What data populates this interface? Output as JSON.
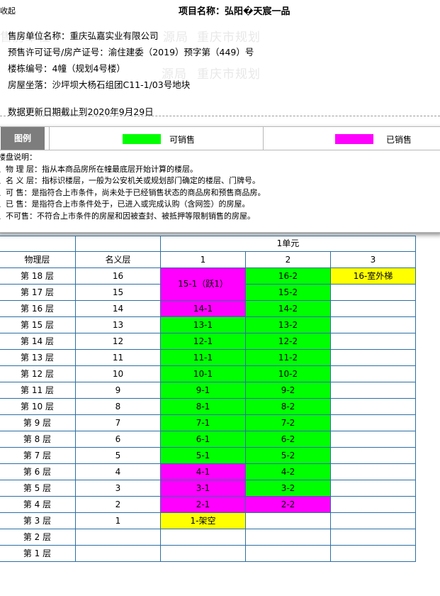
{
  "header": {
    "collapse_label": "收起",
    "project_title": "项目名称：弘阳�天宸一品"
  },
  "info": {
    "developer": "售房单位名称：重庆弘嘉实业有限公司",
    "permit": "预售许可证号/房产证号：渝住建委（2019）预字第（449）号",
    "building": "楼栋编号：4幢（规划4号楼）",
    "location": "房屋坐落：沙坪坝大杨石组团C11-1/03号地块",
    "update": "数据更新日期截止到2020年9月29日"
  },
  "watermarks": [
    "售房单位",
    "源局",
    "重庆市规划",
    "源局",
    "重庆市规划"
  ],
  "legend": {
    "tag": "图例",
    "available_label": "可销售",
    "sold_label": "已销售",
    "available_color": "#00ff00",
    "sold_color": "#ff00ff"
  },
  "notes": [
    "楼盘说明：",
    "、物 理 层：指从本商品房所在幢最底层开始计算的楼层。",
    "、名 义 层：指标识楼层，一般为公安机关或规划部门确定的楼层、门牌号。",
    "、可 售：是指符合上市条件，尚未处于已经销售状态的商品房和预售商品房。",
    "、已 售：是指符合上市条件处于，已进入或完成认购（含网签）的房屋。",
    "、不可售：不符合上市条件的房屋和因被查封、被抵押等限制销售的房屋。"
  ],
  "table": {
    "col_physical": "物理层",
    "col_nominal": "名义层",
    "unit_header": "1单元",
    "unit_cols": [
      "1",
      "2",
      "3"
    ],
    "colors": {
      "green": "#00ff00",
      "magenta": "#ff00ff",
      "yellow": "#ffff00"
    },
    "rows": [
      {
        "physical": "第 18 层",
        "nominal": "16"
      },
      {
        "physical": "第 17 层",
        "nominal": "15"
      },
      {
        "physical": "第 16 层",
        "nominal": "14"
      },
      {
        "physical": "第 15 层",
        "nominal": "13"
      },
      {
        "physical": "第 14 层",
        "nominal": "12"
      },
      {
        "physical": "第 13 层",
        "nominal": "11"
      },
      {
        "physical": "第 12 层",
        "nominal": "10"
      },
      {
        "physical": "第 11 层",
        "nominal": "9"
      },
      {
        "physical": "第 10 层",
        "nominal": "8"
      },
      {
        "physical": "第 9 层",
        "nominal": "7"
      },
      {
        "physical": "第 8 层",
        "nominal": "6"
      },
      {
        "physical": "第 7 层",
        "nominal": "5"
      },
      {
        "physical": "第 6 层",
        "nominal": "4"
      },
      {
        "physical": "第 5 层",
        "nominal": "3"
      },
      {
        "physical": "第 4 层",
        "nominal": "2"
      },
      {
        "physical": "第 3 层",
        "nominal": "1"
      },
      {
        "physical": "第 2 层",
        "nominal": ""
      },
      {
        "physical": "第 1 层",
        "nominal": ""
      }
    ],
    "units": [
      {
        "label": "15-1（跃1）",
        "col": 0,
        "row": 0,
        "span": 2,
        "status": "magenta"
      },
      {
        "label": "16-2",
        "col": 1,
        "row": 0,
        "span": 1,
        "status": "green"
      },
      {
        "label": "16-室外梯",
        "col": 2,
        "row": 0,
        "span": 1,
        "status": "yellow"
      },
      {
        "label": "15-2",
        "col": 1,
        "row": 1,
        "span": 1,
        "status": "green"
      },
      {
        "label": "14-1",
        "col": 0,
        "row": 2,
        "span": 1,
        "status": "magenta"
      },
      {
        "label": "14-2",
        "col": 1,
        "row": 2,
        "span": 1,
        "status": "green"
      },
      {
        "label": "13-1",
        "col": 0,
        "row": 3,
        "span": 1,
        "status": "green"
      },
      {
        "label": "13-2",
        "col": 1,
        "row": 3,
        "span": 1,
        "status": "green"
      },
      {
        "label": "12-1",
        "col": 0,
        "row": 4,
        "span": 1,
        "status": "green"
      },
      {
        "label": "12-2",
        "col": 1,
        "row": 4,
        "span": 1,
        "status": "green"
      },
      {
        "label": "11-1",
        "col": 0,
        "row": 5,
        "span": 1,
        "status": "green"
      },
      {
        "label": "11-2",
        "col": 1,
        "row": 5,
        "span": 1,
        "status": "green"
      },
      {
        "label": "10-1",
        "col": 0,
        "row": 6,
        "span": 1,
        "status": "green"
      },
      {
        "label": "10-2",
        "col": 1,
        "row": 6,
        "span": 1,
        "status": "green"
      },
      {
        "label": "9-1",
        "col": 0,
        "row": 7,
        "span": 1,
        "status": "green"
      },
      {
        "label": "9-2",
        "col": 1,
        "row": 7,
        "span": 1,
        "status": "green"
      },
      {
        "label": "8-1",
        "col": 0,
        "row": 8,
        "span": 1,
        "status": "green"
      },
      {
        "label": "8-2",
        "col": 1,
        "row": 8,
        "span": 1,
        "status": "green"
      },
      {
        "label": "7-1",
        "col": 0,
        "row": 9,
        "span": 1,
        "status": "green"
      },
      {
        "label": "7-2",
        "col": 1,
        "row": 9,
        "span": 1,
        "status": "green"
      },
      {
        "label": "6-1",
        "col": 0,
        "row": 10,
        "span": 1,
        "status": "green"
      },
      {
        "label": "6-2",
        "col": 1,
        "row": 10,
        "span": 1,
        "status": "green"
      },
      {
        "label": "5-1",
        "col": 0,
        "row": 11,
        "span": 1,
        "status": "green"
      },
      {
        "label": "5-2",
        "col": 1,
        "row": 11,
        "span": 1,
        "status": "green"
      },
      {
        "label": "4-1",
        "col": 0,
        "row": 12,
        "span": 1,
        "status": "magenta"
      },
      {
        "label": "4-2",
        "col": 1,
        "row": 12,
        "span": 1,
        "status": "green"
      },
      {
        "label": "3-1",
        "col": 0,
        "row": 13,
        "span": 1,
        "status": "magenta"
      },
      {
        "label": "3-2",
        "col": 1,
        "row": 13,
        "span": 1,
        "status": "green"
      },
      {
        "label": "2-1",
        "col": 0,
        "row": 14,
        "span": 1,
        "status": "magenta"
      },
      {
        "label": "2-2",
        "col": 1,
        "row": 14,
        "span": 1,
        "status": "magenta"
      },
      {
        "label": "1-架空",
        "col": 0,
        "row": 15,
        "span": 1,
        "status": "yellow"
      }
    ]
  }
}
